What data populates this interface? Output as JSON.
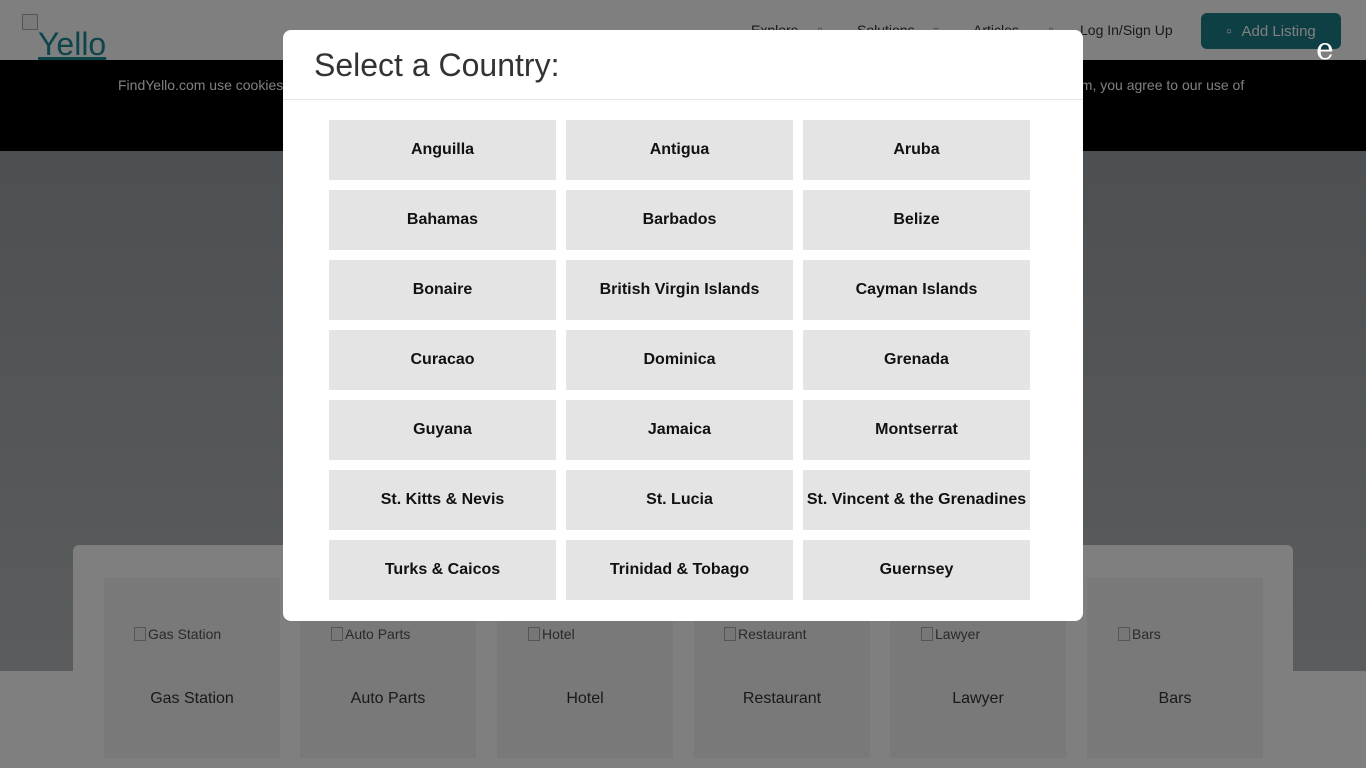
{
  "header": {
    "logo_alt": "Yello",
    "nav": {
      "explore": "Explore",
      "solutions": "Solutions",
      "articles": "Articles",
      "login": "Log In/Sign Up"
    },
    "add_listing": "Add Listing"
  },
  "cookie": {
    "text_left": "FindYello.com use cookies",
    "text_right": "om, you agree to our use of"
  },
  "categories": [
    {
      "image_alt": "Gas Station",
      "label": "Gas Station"
    },
    {
      "image_alt": "Auto Parts",
      "label": "Auto Parts"
    },
    {
      "image_alt": "Hotel",
      "label": "Hotel"
    },
    {
      "image_alt": "Restaurant",
      "label": "Restaurant"
    },
    {
      "image_alt": "Lawyer",
      "label": "Lawyer"
    },
    {
      "image_alt": "Bars",
      "label": "Bars"
    }
  ],
  "modal": {
    "title": "Select a Country:",
    "close_glyph": "e",
    "countries": [
      "Anguilla",
      "Antigua",
      "Aruba",
      "Bahamas",
      "Barbados",
      "Belize",
      "Bonaire",
      "British Virgin Islands",
      "Cayman Islands",
      "Curacao",
      "Dominica",
      "Grenada",
      "Guyana",
      "Jamaica",
      "Montserrat",
      "St. Kitts & Nevis",
      "St. Lucia",
      "St. Vincent & the Grenadines",
      "Turks & Caicos",
      "Trinidad & Tobago",
      "Guernsey"
    ]
  },
  "colors": {
    "brand": "#1b7f8a",
    "button_bg": "#e4e4e4",
    "overlay": "rgba(0,0,0,0.5)"
  },
  "icons": {
    "explore": "chevron-down-icon",
    "solutions": "chevron-down-icon",
    "login": "user-icon",
    "add_listing": "plus-icon"
  }
}
